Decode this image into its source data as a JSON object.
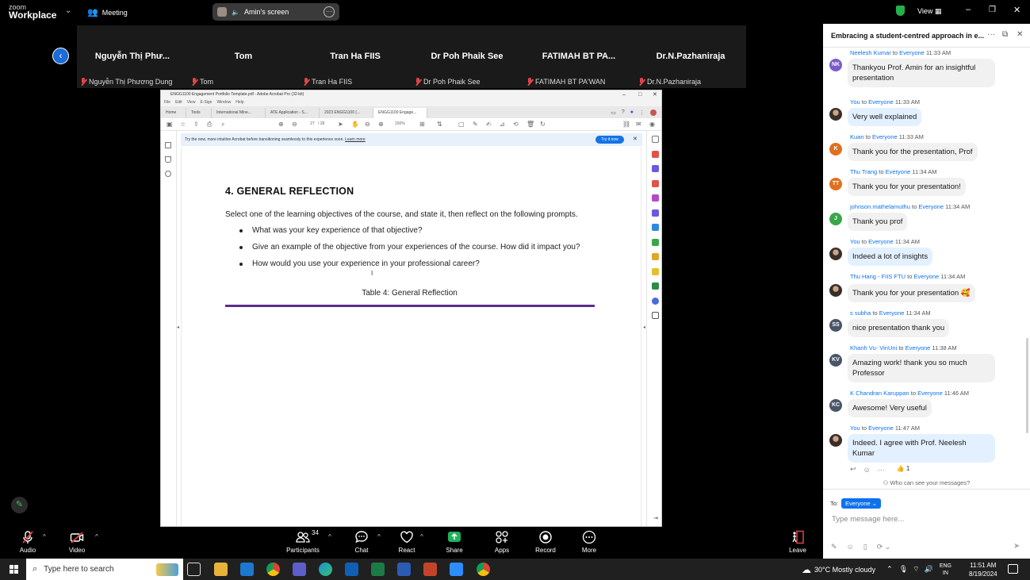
{
  "zoom": {
    "logo_small": "zoom",
    "logo_big": "Workplace",
    "meeting_label": "Meeting",
    "screen_label": "Amin's screen",
    "view_label": "View"
  },
  "participants": [
    {
      "name": "Nguyễn Thị Phư...",
      "sub": "Nguyễn Thị Phương Dung"
    },
    {
      "name": "Tom",
      "sub": "Tom"
    },
    {
      "name": "Tran Ha FIIS",
      "sub": "Tran Ha FIIS"
    },
    {
      "name": "Dr Poh Phaik See",
      "sub": "Dr Poh Phaik See"
    },
    {
      "name": "FATIMAH BT PA...",
      "sub": "FATIMAH BT PA'WAN"
    },
    {
      "name": "Dr.N.Pazhaniraja",
      "sub": "Dr.N.Pazhaniraja"
    }
  ],
  "acrobat": {
    "title": "ENGG1100 Engagement Portfolio Template.pdf - Adobe Acrobat Pro (32-bit)",
    "menu": [
      "File",
      "Edit",
      "View",
      "E-Sign",
      "Window",
      "Help"
    ],
    "tabs": [
      "Home",
      "Tools",
      "International Mine...",
      "ATE Application - S...",
      "2023 ENGG1100 (...",
      "ENGG1100 Engage..."
    ],
    "page_current": "27",
    "page_total": "/ 28",
    "zoom_level": "150%",
    "banner_text": "Try the new, more intuitive Acrobat before transitioning seamlessly to this experience soon.",
    "banner_link": "Learn more",
    "banner_button": "Try it now",
    "doc": {
      "heading": "4.   GENERAL REFLECTION",
      "paragraph": "Select one of the learning objectives of the course, and state it, then reflect on the following prompts.",
      "bullets": [
        "What was your key experience of that objective?",
        "Give an example of the objective from your experiences of the course. How did it impact you?",
        "How would you use your experience in your professional career?"
      ],
      "caption": "Table 4: General Reflection"
    }
  },
  "toolbar": {
    "audio": "Audio",
    "video": "Video",
    "participants": "Participants",
    "participants_count": "34",
    "chat": "Chat",
    "react": "React",
    "share": "Share",
    "apps": "Apps",
    "record": "Record",
    "more": "More",
    "leave": "Leave"
  },
  "chat": {
    "title": "Embracing a student-centred approach in e...",
    "to_word": "to",
    "messages": [
      {
        "sender": "Neelesh Kumar",
        "to": "Everyone",
        "time": "11:33 AM",
        "initials": "NK",
        "color": "#7c5bc9",
        "lines": [
          "Thankyou Prof. Amin for an insightful",
          "presentation"
        ],
        "mine": false
      },
      {
        "sender": "You",
        "to": "Everyone",
        "time": "11:33 AM",
        "initials": "",
        "color": "#6b5a52",
        "lines": [
          "Very well explained"
        ],
        "mine": true
      },
      {
        "sender": "Kuan",
        "to": "Everyone",
        "time": "11:33 AM",
        "initials": "K",
        "color": "#e0701f",
        "lines": [
          "Thank you for the presentation, Prof"
        ],
        "mine": false
      },
      {
        "sender": "Thu Trang",
        "to": "Everyone",
        "time": "11:34 AM",
        "initials": "TT",
        "color": "#e0701f",
        "lines": [
          "Thank you for your  presentation!"
        ],
        "mine": false
      },
      {
        "sender": "johnson.mathelamuthu",
        "to": "Everyone",
        "time": "11:34 AM",
        "initials": "J",
        "color": "#3aa64a",
        "lines": [
          "Thank you prof"
        ],
        "mine": false
      },
      {
        "sender": "You",
        "to": "Everyone",
        "time": "11:34 AM",
        "initials": "",
        "color": "#6b5a52",
        "lines": [
          "Indeed a lot of insights"
        ],
        "mine": true
      },
      {
        "sender": "Thu Hang - FIIS FTU",
        "to": "Everyone",
        "time": "11:34 AM",
        "initials": "",
        "color": "#d9d2c9",
        "lines": [
          "Thank you for your presentation 🥰"
        ],
        "mine": false
      },
      {
        "sender": "s subha",
        "to": "Everyone",
        "time": "11:34 AM",
        "initials": "SS",
        "color": "#4a5568",
        "lines": [
          "nice presentation thank you"
        ],
        "mine": false
      },
      {
        "sender": "Khanh Vu- VinUni",
        "to": "Everyone",
        "time": "11:38 AM",
        "initials": "KV",
        "color": "#4a5568",
        "lines": [
          "Amazing work! thank you so much",
          "Professor"
        ],
        "mine": false
      },
      {
        "sender": "K Chandran Karuppan",
        "to": "Everyone",
        "time": "11:46 AM",
        "initials": "KC",
        "color": "#4a5568",
        "lines": [
          "Awesome! Very useful"
        ],
        "mine": false
      },
      {
        "sender": "You",
        "to": "Everyone",
        "time": "11:47 AM",
        "initials": "",
        "color": "#6b5a52",
        "lines": [
          "Indeed. I agree with Prof. Neelesh",
          "Kumar"
        ],
        "mine": true
      }
    ],
    "reaction": "👍 1",
    "who_can_see": "Who can see your messages?",
    "to_label": "To:",
    "recipient": "Everyone",
    "input_placeholder": "Type message here..."
  },
  "taskbar": {
    "search_placeholder": "Type here to search",
    "weather": "30°C  Mostly cloudy",
    "lang1": "ENG",
    "lang2": "IN",
    "time": "11:51 AM",
    "date": "8/19/2024"
  }
}
